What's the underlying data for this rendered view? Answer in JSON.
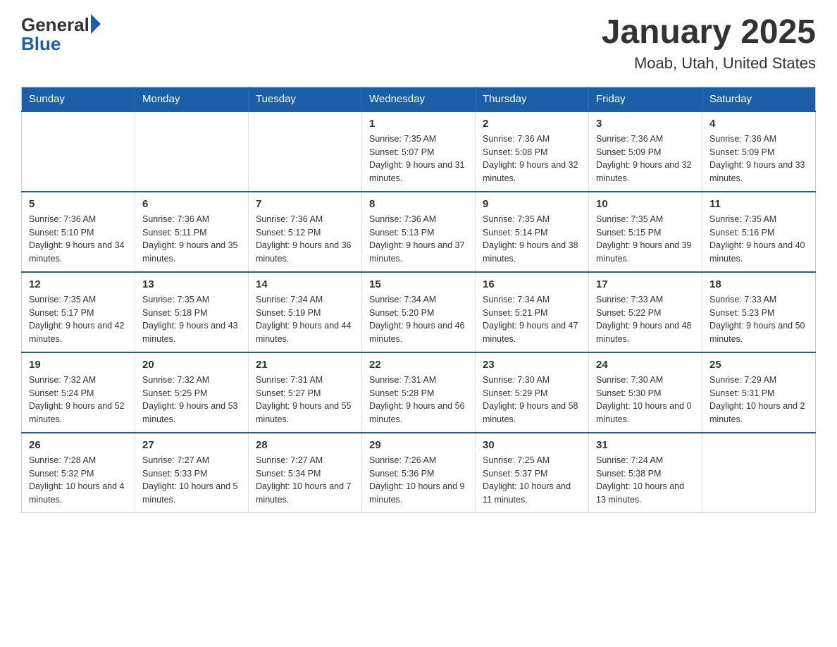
{
  "header": {
    "logo_general": "General",
    "logo_blue": "Blue",
    "title": "January 2025",
    "subtitle": "Moab, Utah, United States"
  },
  "calendar": {
    "days_of_week": [
      "Sunday",
      "Monday",
      "Tuesday",
      "Wednesday",
      "Thursday",
      "Friday",
      "Saturday"
    ],
    "weeks": [
      [
        {
          "day": "",
          "info": ""
        },
        {
          "day": "",
          "info": ""
        },
        {
          "day": "",
          "info": ""
        },
        {
          "day": "1",
          "info": "Sunrise: 7:35 AM\nSunset: 5:07 PM\nDaylight: 9 hours and 31 minutes."
        },
        {
          "day": "2",
          "info": "Sunrise: 7:36 AM\nSunset: 5:08 PM\nDaylight: 9 hours and 32 minutes."
        },
        {
          "day": "3",
          "info": "Sunrise: 7:36 AM\nSunset: 5:09 PM\nDaylight: 9 hours and 32 minutes."
        },
        {
          "day": "4",
          "info": "Sunrise: 7:36 AM\nSunset: 5:09 PM\nDaylight: 9 hours and 33 minutes."
        }
      ],
      [
        {
          "day": "5",
          "info": "Sunrise: 7:36 AM\nSunset: 5:10 PM\nDaylight: 9 hours and 34 minutes."
        },
        {
          "day": "6",
          "info": "Sunrise: 7:36 AM\nSunset: 5:11 PM\nDaylight: 9 hours and 35 minutes."
        },
        {
          "day": "7",
          "info": "Sunrise: 7:36 AM\nSunset: 5:12 PM\nDaylight: 9 hours and 36 minutes."
        },
        {
          "day": "8",
          "info": "Sunrise: 7:36 AM\nSunset: 5:13 PM\nDaylight: 9 hours and 37 minutes."
        },
        {
          "day": "9",
          "info": "Sunrise: 7:35 AM\nSunset: 5:14 PM\nDaylight: 9 hours and 38 minutes."
        },
        {
          "day": "10",
          "info": "Sunrise: 7:35 AM\nSunset: 5:15 PM\nDaylight: 9 hours and 39 minutes."
        },
        {
          "day": "11",
          "info": "Sunrise: 7:35 AM\nSunset: 5:16 PM\nDaylight: 9 hours and 40 minutes."
        }
      ],
      [
        {
          "day": "12",
          "info": "Sunrise: 7:35 AM\nSunset: 5:17 PM\nDaylight: 9 hours and 42 minutes."
        },
        {
          "day": "13",
          "info": "Sunrise: 7:35 AM\nSunset: 5:18 PM\nDaylight: 9 hours and 43 minutes."
        },
        {
          "day": "14",
          "info": "Sunrise: 7:34 AM\nSunset: 5:19 PM\nDaylight: 9 hours and 44 minutes."
        },
        {
          "day": "15",
          "info": "Sunrise: 7:34 AM\nSunset: 5:20 PM\nDaylight: 9 hours and 46 minutes."
        },
        {
          "day": "16",
          "info": "Sunrise: 7:34 AM\nSunset: 5:21 PM\nDaylight: 9 hours and 47 minutes."
        },
        {
          "day": "17",
          "info": "Sunrise: 7:33 AM\nSunset: 5:22 PM\nDaylight: 9 hours and 48 minutes."
        },
        {
          "day": "18",
          "info": "Sunrise: 7:33 AM\nSunset: 5:23 PM\nDaylight: 9 hours and 50 minutes."
        }
      ],
      [
        {
          "day": "19",
          "info": "Sunrise: 7:32 AM\nSunset: 5:24 PM\nDaylight: 9 hours and 52 minutes."
        },
        {
          "day": "20",
          "info": "Sunrise: 7:32 AM\nSunset: 5:25 PM\nDaylight: 9 hours and 53 minutes."
        },
        {
          "day": "21",
          "info": "Sunrise: 7:31 AM\nSunset: 5:27 PM\nDaylight: 9 hours and 55 minutes."
        },
        {
          "day": "22",
          "info": "Sunrise: 7:31 AM\nSunset: 5:28 PM\nDaylight: 9 hours and 56 minutes."
        },
        {
          "day": "23",
          "info": "Sunrise: 7:30 AM\nSunset: 5:29 PM\nDaylight: 9 hours and 58 minutes."
        },
        {
          "day": "24",
          "info": "Sunrise: 7:30 AM\nSunset: 5:30 PM\nDaylight: 10 hours and 0 minutes."
        },
        {
          "day": "25",
          "info": "Sunrise: 7:29 AM\nSunset: 5:31 PM\nDaylight: 10 hours and 2 minutes."
        }
      ],
      [
        {
          "day": "26",
          "info": "Sunrise: 7:28 AM\nSunset: 5:32 PM\nDaylight: 10 hours and 4 minutes."
        },
        {
          "day": "27",
          "info": "Sunrise: 7:27 AM\nSunset: 5:33 PM\nDaylight: 10 hours and 5 minutes."
        },
        {
          "day": "28",
          "info": "Sunrise: 7:27 AM\nSunset: 5:34 PM\nDaylight: 10 hours and 7 minutes."
        },
        {
          "day": "29",
          "info": "Sunrise: 7:26 AM\nSunset: 5:36 PM\nDaylight: 10 hours and 9 minutes."
        },
        {
          "day": "30",
          "info": "Sunrise: 7:25 AM\nSunset: 5:37 PM\nDaylight: 10 hours and 11 minutes."
        },
        {
          "day": "31",
          "info": "Sunrise: 7:24 AM\nSunset: 5:38 PM\nDaylight: 10 hours and 13 minutes."
        },
        {
          "day": "",
          "info": ""
        }
      ]
    ]
  }
}
